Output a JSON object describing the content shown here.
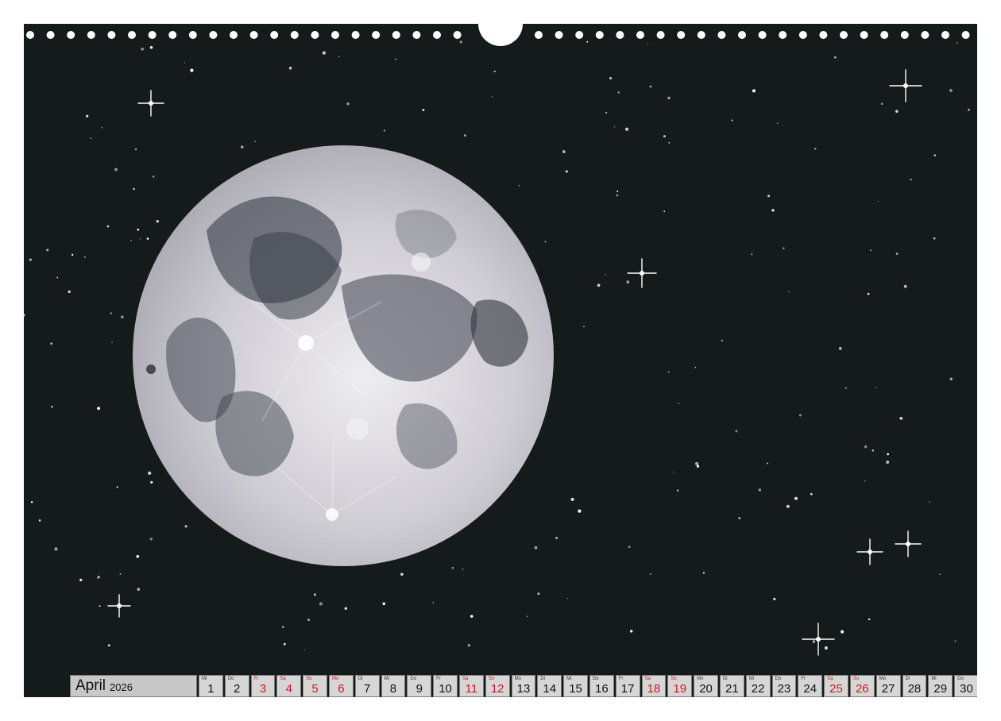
{
  "calendar": {
    "month": "April",
    "year": "2026",
    "colors": {
      "weekend_holiday": "#cc1a1a",
      "cell_bg": "#d6d6d6",
      "text": "#111111"
    },
    "days": [
      {
        "wd": "Mi",
        "n": "1",
        "red": false
      },
      {
        "wd": "Do",
        "n": "2",
        "red": false
      },
      {
        "wd": "Fr",
        "n": "3",
        "red": true
      },
      {
        "wd": "Sa",
        "n": "4",
        "red": true
      },
      {
        "wd": "So",
        "n": "5",
        "red": true
      },
      {
        "wd": "Mo",
        "n": "6",
        "red": true
      },
      {
        "wd": "Di",
        "n": "7",
        "red": false
      },
      {
        "wd": "Mi",
        "n": "8",
        "red": false
      },
      {
        "wd": "Do",
        "n": "9",
        "red": false
      },
      {
        "wd": "Fr",
        "n": "10",
        "red": false
      },
      {
        "wd": "Sa",
        "n": "11",
        "red": true
      },
      {
        "wd": "So",
        "n": "12",
        "red": true
      },
      {
        "wd": "Mo",
        "n": "13",
        "red": false
      },
      {
        "wd": "Di",
        "n": "14",
        "red": false
      },
      {
        "wd": "Mi",
        "n": "15",
        "red": false
      },
      {
        "wd": "Do",
        "n": "16",
        "red": false
      },
      {
        "wd": "Fr",
        "n": "17",
        "red": false
      },
      {
        "wd": "Sa",
        "n": "18",
        "red": true
      },
      {
        "wd": "So",
        "n": "19",
        "red": true
      },
      {
        "wd": "Mo",
        "n": "20",
        "red": false
      },
      {
        "wd": "Di",
        "n": "21",
        "red": false
      },
      {
        "wd": "Mi",
        "n": "22",
        "red": false
      },
      {
        "wd": "Do",
        "n": "23",
        "red": false
      },
      {
        "wd": "Fr",
        "n": "24",
        "red": false
      },
      {
        "wd": "Sa",
        "n": "25",
        "red": true
      },
      {
        "wd": "So",
        "n": "26",
        "red": true
      },
      {
        "wd": "Mo",
        "n": "27",
        "red": false
      },
      {
        "wd": "Di",
        "n": "28",
        "red": false
      },
      {
        "wd": "Mi",
        "n": "29",
        "red": false
      },
      {
        "wd": "Do",
        "n": "30",
        "red": false
      }
    ]
  },
  "artwork": {
    "subject": "moon-icon",
    "background_color": "#151a1a",
    "moon_color": "#d9d7dc"
  }
}
